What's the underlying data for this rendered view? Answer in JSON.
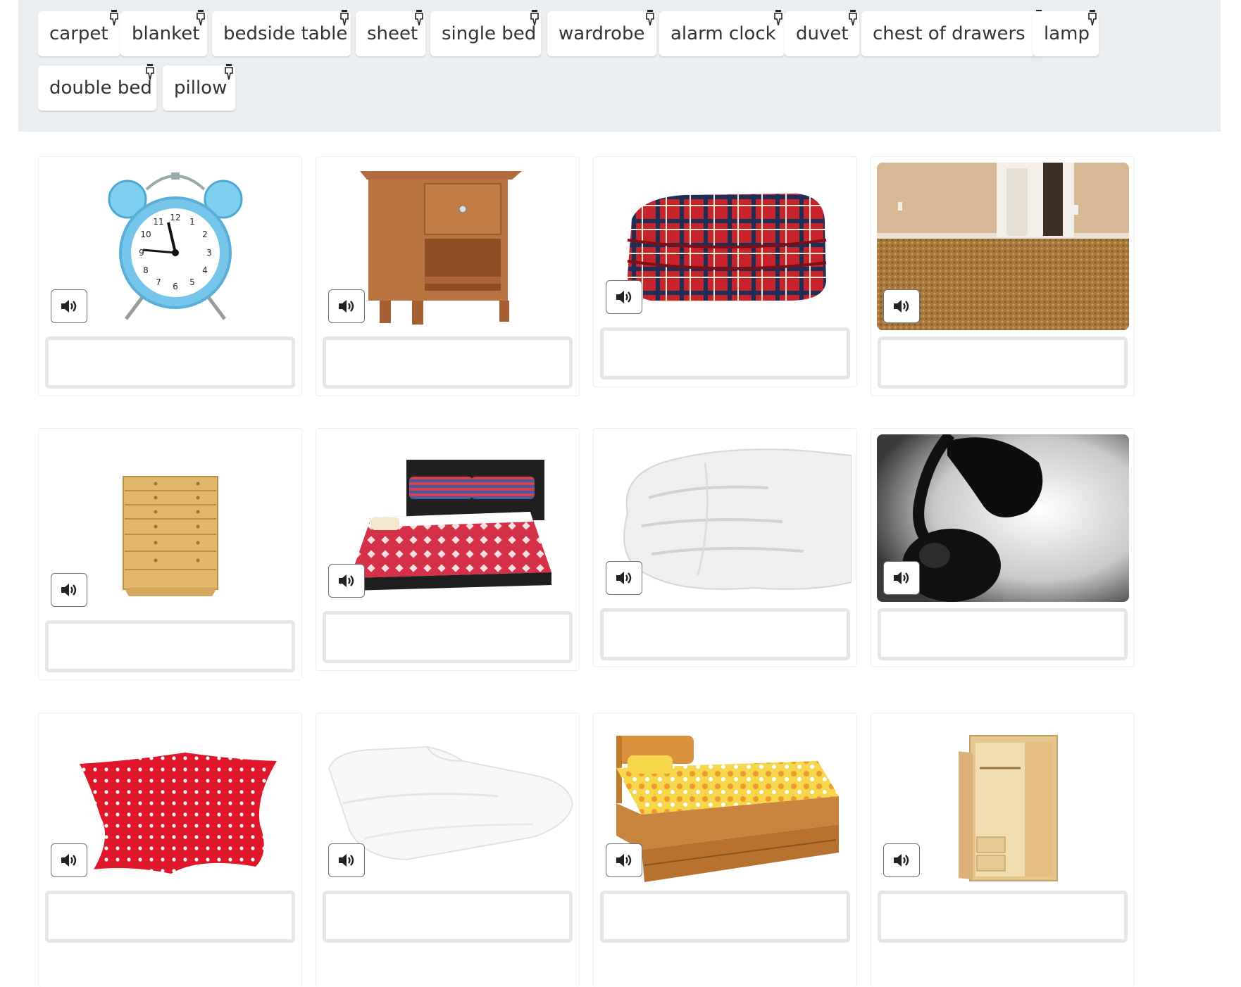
{
  "word_bank": {
    "words": [
      "carpet",
      "blanket",
      "bedside table",
      "sheet",
      "single bed",
      "wardrobe",
      "alarm clock",
      "duvet",
      "chest of drawers",
      "lamp",
      "double bed",
      "pillow"
    ]
  },
  "cards": [
    {
      "image": "alarm-clock-image"
    },
    {
      "image": "bedside-table-image"
    },
    {
      "image": "blanket-image"
    },
    {
      "image": "carpet-image"
    },
    {
      "image": "chest-of-drawers-image"
    },
    {
      "image": "double-bed-image"
    },
    {
      "image": "duvet-image"
    },
    {
      "image": "lamp-image"
    },
    {
      "image": "pillow-image"
    },
    {
      "image": "sheet-image"
    },
    {
      "image": "single-bed-image"
    },
    {
      "image": "wardrobe-image"
    }
  ],
  "clock_face": {
    "n12": "12",
    "n1": "1",
    "n2": "2",
    "n3": "3",
    "n4": "4",
    "n5": "5",
    "n6": "6",
    "n7": "7",
    "n8": "8",
    "n9": "9",
    "n10": "10",
    "n11": "11"
  },
  "icons": {
    "audio": "speaker-icon",
    "drag": "drag-pin-icon"
  },
  "colors": {
    "bank_bg": "#ebeef0",
    "chip_bg": "#ffffff",
    "drop_border": "#e6e6e6",
    "text": "#333333"
  }
}
